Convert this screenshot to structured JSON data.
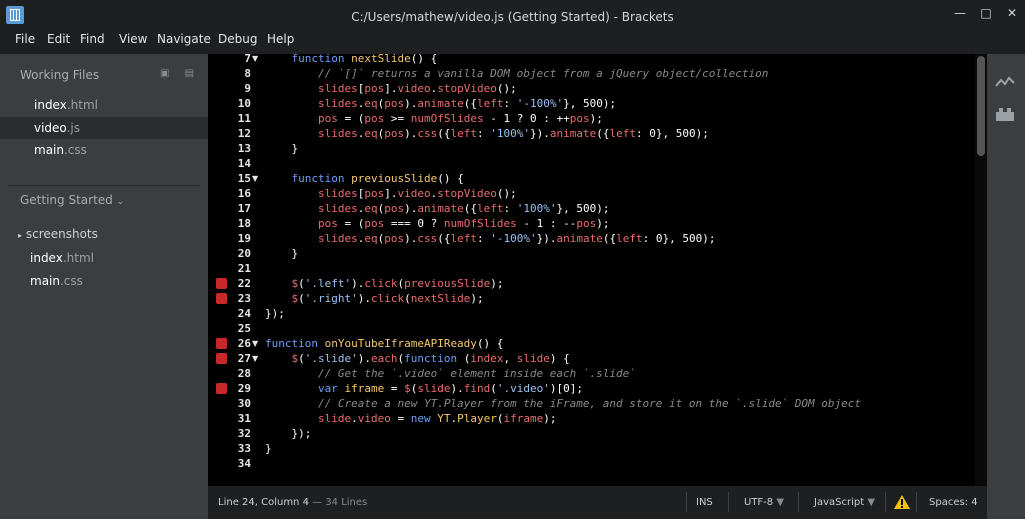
{
  "window": {
    "title": "C:/Users/mathew/video.js (Getting Started) - Brackets",
    "controls": {
      "minimize": "—",
      "maximize": "□",
      "close": "✕"
    }
  },
  "menu": [
    "File",
    "Edit",
    "Find",
    "View",
    "Navigate",
    "Debug",
    "Help"
  ],
  "sidebar": {
    "working_files_title": "Working Files",
    "working_files": [
      {
        "name": "index",
        "ext": ".html",
        "active": false
      },
      {
        "name": "video",
        "ext": ".js",
        "active": true
      },
      {
        "name": "main",
        "ext": ".css",
        "active": false
      }
    ],
    "project_title": "Getting Started",
    "project_folder": "screenshots",
    "project_files": [
      {
        "name": "index",
        "ext": ".html"
      },
      {
        "name": "main",
        "ext": ".css"
      }
    ]
  },
  "editor": {
    "lines": [
      {
        "n": 7,
        "fold": "▼",
        "bp": false,
        "tokens": [
          [
            "    ",
            "txt"
          ],
          [
            "function",
            "kw"
          ],
          [
            " ",
            "txt"
          ],
          [
            "nextSlide",
            "fn"
          ],
          [
            "() {",
            "txt"
          ]
        ]
      },
      {
        "n": 8,
        "fold": "",
        "bp": false,
        "tokens": [
          [
            "        ",
            "txt"
          ],
          [
            "// `[]` returns a vanilla DOM object from a jQuery object/collection",
            "com"
          ]
        ]
      },
      {
        "n": 9,
        "fold": "",
        "bp": false,
        "tokens": [
          [
            "        ",
            "txt"
          ],
          [
            "slides",
            "var"
          ],
          [
            "[",
            "txt"
          ],
          [
            "pos",
            "var"
          ],
          [
            "].",
            "txt"
          ],
          [
            "video",
            "var"
          ],
          [
            ".",
            "txt"
          ],
          [
            "stopVideo",
            "var"
          ],
          [
            "();",
            "txt"
          ]
        ]
      },
      {
        "n": 10,
        "fold": "",
        "bp": false,
        "tokens": [
          [
            "        ",
            "txt"
          ],
          [
            "slides",
            "var"
          ],
          [
            ".",
            "txt"
          ],
          [
            "eq",
            "var"
          ],
          [
            "(",
            "txt"
          ],
          [
            "pos",
            "var"
          ],
          [
            ").",
            "txt"
          ],
          [
            "animate",
            "var"
          ],
          [
            "({",
            "txt"
          ],
          [
            "left",
            "var"
          ],
          [
            ": ",
            "txt"
          ],
          [
            "'-100%'",
            "str"
          ],
          [
            "}, ",
            "txt"
          ],
          [
            "500",
            "num"
          ],
          [
            ");",
            "txt"
          ]
        ]
      },
      {
        "n": 11,
        "fold": "",
        "bp": false,
        "tokens": [
          [
            "        ",
            "txt"
          ],
          [
            "pos",
            "var"
          ],
          [
            " = (",
            "txt"
          ],
          [
            "pos",
            "var"
          ],
          [
            " >= ",
            "txt"
          ],
          [
            "numOfSlides",
            "var"
          ],
          [
            " - ",
            "txt"
          ],
          [
            "1",
            "num"
          ],
          [
            " ? ",
            "txt"
          ],
          [
            "0",
            "num"
          ],
          [
            " : ++",
            "txt"
          ],
          [
            "pos",
            "var"
          ],
          [
            ");",
            "txt"
          ]
        ]
      },
      {
        "n": 12,
        "fold": "",
        "bp": false,
        "tokens": [
          [
            "        ",
            "txt"
          ],
          [
            "slides",
            "var"
          ],
          [
            ".",
            "txt"
          ],
          [
            "eq",
            "var"
          ],
          [
            "(",
            "txt"
          ],
          [
            "pos",
            "var"
          ],
          [
            ").",
            "txt"
          ],
          [
            "css",
            "var"
          ],
          [
            "({",
            "txt"
          ],
          [
            "left",
            "var"
          ],
          [
            ": ",
            "txt"
          ],
          [
            "'100%'",
            "str"
          ],
          [
            "}).",
            "txt"
          ],
          [
            "animate",
            "var"
          ],
          [
            "({",
            "txt"
          ],
          [
            "left",
            "var"
          ],
          [
            ": ",
            "txt"
          ],
          [
            "0",
            "num"
          ],
          [
            "}, ",
            "txt"
          ],
          [
            "500",
            "num"
          ],
          [
            ");",
            "txt"
          ]
        ]
      },
      {
        "n": 13,
        "fold": "",
        "bp": false,
        "tokens": [
          [
            "    }",
            "txt"
          ]
        ]
      },
      {
        "n": 14,
        "fold": "",
        "bp": false,
        "tokens": []
      },
      {
        "n": 15,
        "fold": "▼",
        "bp": false,
        "tokens": [
          [
            "    ",
            "txt"
          ],
          [
            "function",
            "kw"
          ],
          [
            " ",
            "txt"
          ],
          [
            "previousSlide",
            "fn"
          ],
          [
            "() {",
            "txt"
          ]
        ]
      },
      {
        "n": 16,
        "fold": "",
        "bp": false,
        "tokens": [
          [
            "        ",
            "txt"
          ],
          [
            "slides",
            "var"
          ],
          [
            "[",
            "txt"
          ],
          [
            "pos",
            "var"
          ],
          [
            "].",
            "txt"
          ],
          [
            "video",
            "var"
          ],
          [
            ".",
            "txt"
          ],
          [
            "stopVideo",
            "var"
          ],
          [
            "();",
            "txt"
          ]
        ]
      },
      {
        "n": 17,
        "fold": "",
        "bp": false,
        "tokens": [
          [
            "        ",
            "txt"
          ],
          [
            "slides",
            "var"
          ],
          [
            ".",
            "txt"
          ],
          [
            "eq",
            "var"
          ],
          [
            "(",
            "txt"
          ],
          [
            "pos",
            "var"
          ],
          [
            ").",
            "txt"
          ],
          [
            "animate",
            "var"
          ],
          [
            "({",
            "txt"
          ],
          [
            "left",
            "var"
          ],
          [
            ": ",
            "txt"
          ],
          [
            "'100%'",
            "str"
          ],
          [
            "}, ",
            "txt"
          ],
          [
            "500",
            "num"
          ],
          [
            ");",
            "txt"
          ]
        ]
      },
      {
        "n": 18,
        "fold": "",
        "bp": false,
        "tokens": [
          [
            "        ",
            "txt"
          ],
          [
            "pos",
            "var"
          ],
          [
            " = (",
            "txt"
          ],
          [
            "pos",
            "var"
          ],
          [
            " === ",
            "txt"
          ],
          [
            "0",
            "num"
          ],
          [
            " ? ",
            "txt"
          ],
          [
            "numOfSlides",
            "var"
          ],
          [
            " - ",
            "txt"
          ],
          [
            "1",
            "num"
          ],
          [
            " : --",
            "txt"
          ],
          [
            "pos",
            "var"
          ],
          [
            ");",
            "txt"
          ]
        ]
      },
      {
        "n": 19,
        "fold": "",
        "bp": false,
        "tokens": [
          [
            "        ",
            "txt"
          ],
          [
            "slides",
            "var"
          ],
          [
            ".",
            "txt"
          ],
          [
            "eq",
            "var"
          ],
          [
            "(",
            "txt"
          ],
          [
            "pos",
            "var"
          ],
          [
            ").",
            "txt"
          ],
          [
            "css",
            "var"
          ],
          [
            "({",
            "txt"
          ],
          [
            "left",
            "var"
          ],
          [
            ": ",
            "txt"
          ],
          [
            "'-100%'",
            "str"
          ],
          [
            "}).",
            "txt"
          ],
          [
            "animate",
            "var"
          ],
          [
            "({",
            "txt"
          ],
          [
            "left",
            "var"
          ],
          [
            ": ",
            "txt"
          ],
          [
            "0",
            "num"
          ],
          [
            "}, ",
            "txt"
          ],
          [
            "500",
            "num"
          ],
          [
            ");",
            "txt"
          ]
        ]
      },
      {
        "n": 20,
        "fold": "",
        "bp": false,
        "tokens": [
          [
            "    }",
            "txt"
          ]
        ]
      },
      {
        "n": 21,
        "fold": "",
        "bp": false,
        "tokens": []
      },
      {
        "n": 22,
        "fold": "",
        "bp": true,
        "tokens": [
          [
            "    ",
            "txt"
          ],
          [
            "$",
            "var"
          ],
          [
            "(",
            "txt"
          ],
          [
            "'.left'",
            "str"
          ],
          [
            ").",
            "txt"
          ],
          [
            "click",
            "var"
          ],
          [
            "(",
            "txt"
          ],
          [
            "previousSlide",
            "var"
          ],
          [
            ");",
            "txt"
          ]
        ]
      },
      {
        "n": 23,
        "fold": "",
        "bp": true,
        "tokens": [
          [
            "    ",
            "txt"
          ],
          [
            "$",
            "var"
          ],
          [
            "(",
            "txt"
          ],
          [
            "'.right'",
            "str"
          ],
          [
            ").",
            "txt"
          ],
          [
            "click",
            "var"
          ],
          [
            "(",
            "txt"
          ],
          [
            "nextSlide",
            "var"
          ],
          [
            ");",
            "txt"
          ]
        ]
      },
      {
        "n": 24,
        "fold": "",
        "bp": false,
        "tokens": [
          [
            "});",
            "txt"
          ]
        ]
      },
      {
        "n": 25,
        "fold": "",
        "bp": false,
        "tokens": []
      },
      {
        "n": 26,
        "fold": "▼",
        "bp": true,
        "tokens": [
          [
            "function",
            "kw"
          ],
          [
            " ",
            "txt"
          ],
          [
            "onYouTubeIframeAPIReady",
            "fn"
          ],
          [
            "() {",
            "txt"
          ]
        ]
      },
      {
        "n": 27,
        "fold": "▼",
        "bp": true,
        "tokens": [
          [
            "    ",
            "txt"
          ],
          [
            "$",
            "var"
          ],
          [
            "(",
            "txt"
          ],
          [
            "'.slide'",
            "str"
          ],
          [
            ").",
            "txt"
          ],
          [
            "each",
            "var"
          ],
          [
            "(",
            "txt"
          ],
          [
            "function",
            "kw"
          ],
          [
            " (",
            "txt"
          ],
          [
            "index",
            "var"
          ],
          [
            ", ",
            "txt"
          ],
          [
            "slide",
            "var"
          ],
          [
            ") {",
            "txt"
          ]
        ]
      },
      {
        "n": 28,
        "fold": "",
        "bp": false,
        "tokens": [
          [
            "        ",
            "txt"
          ],
          [
            "// Get the `.video` element inside each `.slide`",
            "com"
          ]
        ]
      },
      {
        "n": 29,
        "fold": "",
        "bp": true,
        "tokens": [
          [
            "        ",
            "txt"
          ],
          [
            "var",
            "kw"
          ],
          [
            " ",
            "txt"
          ],
          [
            "iframe",
            "fn"
          ],
          [
            " = ",
            "txt"
          ],
          [
            "$",
            "var"
          ],
          [
            "(",
            "txt"
          ],
          [
            "slide",
            "var"
          ],
          [
            ").",
            "txt"
          ],
          [
            "find",
            "var"
          ],
          [
            "(",
            "txt"
          ],
          [
            "'.video'",
            "str"
          ],
          [
            ")[",
            "txt"
          ],
          [
            "0",
            "num"
          ],
          [
            "];",
            "txt"
          ]
        ]
      },
      {
        "n": 30,
        "fold": "",
        "bp": false,
        "tokens": [
          [
            "        ",
            "txt"
          ],
          [
            "// Create a new YT.Player from the iFrame, and store it on the `.slide` DOM object",
            "com"
          ]
        ]
      },
      {
        "n": 31,
        "fold": "",
        "bp": false,
        "tokens": [
          [
            "        ",
            "txt"
          ],
          [
            "slide",
            "var"
          ],
          [
            ".",
            "txt"
          ],
          [
            "video",
            "var"
          ],
          [
            " = ",
            "txt"
          ],
          [
            "new",
            "kw"
          ],
          [
            " ",
            "txt"
          ],
          [
            "YT",
            "fn"
          ],
          [
            ".",
            "txt"
          ],
          [
            "Player",
            "fn"
          ],
          [
            "(",
            "txt"
          ],
          [
            "iframe",
            "var"
          ],
          [
            ");",
            "txt"
          ]
        ]
      },
      {
        "n": 32,
        "fold": "",
        "bp": false,
        "tokens": [
          [
            "    });",
            "txt"
          ]
        ]
      },
      {
        "n": 33,
        "fold": "",
        "bp": false,
        "tokens": [
          [
            "}",
            "txt"
          ]
        ]
      },
      {
        "n": 34,
        "fold": "",
        "bp": false,
        "tokens": []
      }
    ]
  },
  "status": {
    "cursor": "Line 24, Column 4",
    "lines": " — 34 Lines",
    "mode": "INS",
    "encoding": "UTF-8",
    "language": "JavaScript",
    "spaces_label": "Spaces:",
    "spaces": "4"
  },
  "colors": {
    "keyword": "#6c9ef8",
    "function": "#f7c86d",
    "string": "#9bc3f5",
    "comment": "#8a8a8a",
    "variable": "#ea6d6d",
    "breakpoint": "#c8282a"
  }
}
